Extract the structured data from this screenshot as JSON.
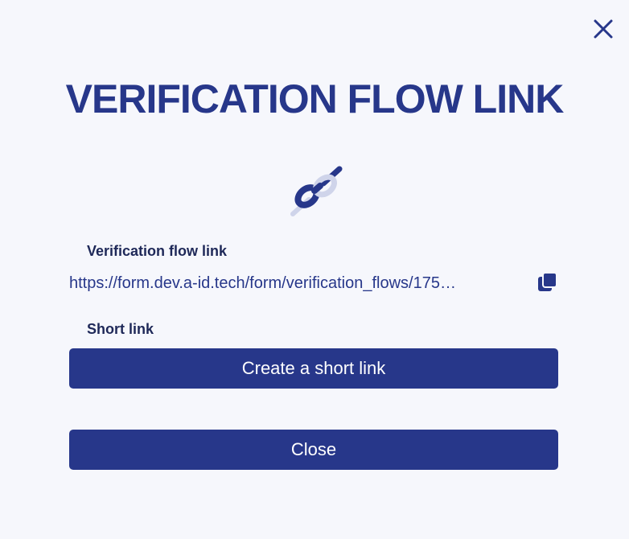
{
  "dialog": {
    "title": "VERIFICATION FLOW LINK",
    "close_icon": "close-icon",
    "link_icon": "chain-link-icon"
  },
  "verification_flow": {
    "label": "Verification flow link",
    "url": "https://form.dev.a-id.tech/form/verification_flows/175…",
    "copy_icon": "copy-icon"
  },
  "short_link": {
    "label": "Short link",
    "create_label": "Create a short link"
  },
  "footer": {
    "close_label": "Close"
  },
  "colors": {
    "brand": "#27378a",
    "background": "#f6f7fc",
    "label_text": "#1e2858",
    "button_text": "#ffffff"
  }
}
